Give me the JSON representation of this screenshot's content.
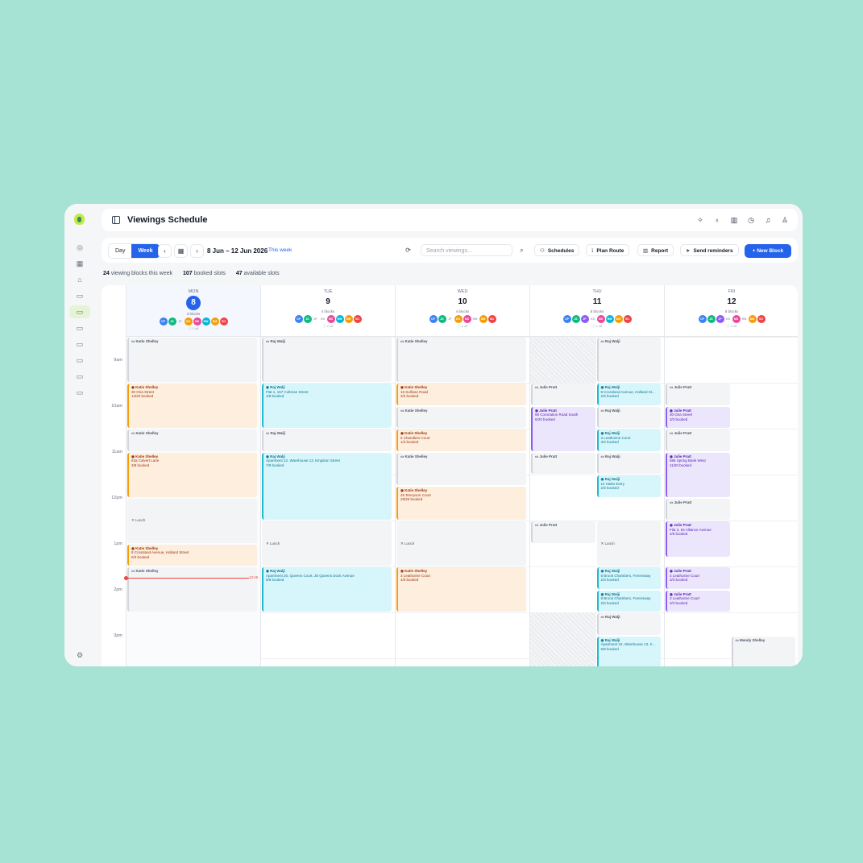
{
  "app": {
    "title": "Viewings Schedule"
  },
  "rail": {
    "icons": [
      "dashboard-icon",
      "calendar-icon",
      "home-icon",
      "folder-icon",
      "folder-icon",
      "folder-icon",
      "folder-icon",
      "folder-icon",
      "folder-icon",
      "folder-icon",
      "settings-icon"
    ],
    "active_index": 4
  },
  "header_icons": [
    "sparkle-icon",
    "lightbulb-icon",
    "map-icon",
    "clock-icon",
    "bell-icon",
    "user-icon"
  ],
  "toolbar": {
    "view_day": "Day",
    "view_week": "Week",
    "active_view": "Week",
    "date_range": "8 Jun – 12 Jun 2026",
    "this_week": "This week",
    "search_placeholder": "Search viewings...",
    "schedules": "Schedules",
    "plan_route": "Plan Route",
    "report": "Report",
    "send_reminders": "Send reminders",
    "new_block": "New Block"
  },
  "summary": {
    "blocks_count": "24",
    "blocks_label": "viewing blocks this week",
    "booked_count": "107",
    "booked_label": "booked slots",
    "available_count": "47",
    "available_label": "available slots"
  },
  "colors": {
    "accent": "#2563eb",
    "orange": "#f59e0b",
    "cyan": "#22b8cf",
    "purple": "#8b5cf6",
    "now": "#ef4444"
  },
  "time_labels": [
    "9am",
    "10am",
    "11am",
    "12pm",
    "1pm",
    "2pm",
    "3pm"
  ],
  "now_time": "13:45",
  "days": [
    {
      "dow": "MON",
      "num": "8",
      "today": true,
      "blocks": "3 blocks",
      "off": "1 off",
      "avatars": [
        [
          "CP",
          "#3b82f6"
        ],
        [
          "JS",
          "#10b981"
        ],
        [
          "JP",
          "faded"
        ],
        [
          "KS",
          "#f59e0b"
        ],
        [
          "MS",
          "#ec4899"
        ],
        [
          "RW",
          "#06b6d4"
        ],
        [
          "DM",
          "#f59e0b"
        ],
        [
          "SO",
          "#ef4444"
        ]
      ]
    },
    {
      "dow": "TUE",
      "num": "9",
      "today": false,
      "blocks": "4 blocks",
      "off": "2 off",
      "avatars": [
        [
          "CP",
          "#3b82f6"
        ],
        [
          "JS",
          "#10b981"
        ],
        [
          "JP",
          "faded"
        ],
        [
          "KS",
          "faded"
        ],
        [
          "MS",
          "#ec4899"
        ],
        [
          "RW",
          "#06b6d4"
        ],
        [
          "DM",
          "#f59e0b"
        ],
        [
          "SO",
          "#ef4444"
        ]
      ]
    },
    {
      "dow": "WED",
      "num": "10",
      "today": false,
      "blocks": "4 blocks",
      "off": "2 off",
      "avatars": [
        [
          "CP",
          "#3b82f6"
        ],
        [
          "JS",
          "#10b981"
        ],
        [
          "JP",
          "faded"
        ],
        [
          "KS",
          "#f59e0b"
        ],
        [
          "MS",
          "#ec4899"
        ],
        [
          "RW",
          "faded"
        ],
        [
          "DM",
          "#f59e0b"
        ],
        [
          "SO",
          "#ef4444"
        ]
      ]
    },
    {
      "dow": "THU",
      "num": "11",
      "today": false,
      "blocks": "8 blocks",
      "off": "1 off",
      "avatars": [
        [
          "CP",
          "#3b82f6"
        ],
        [
          "JS",
          "#10b981"
        ],
        [
          "JP",
          "#8b5cf6"
        ],
        [
          "KS",
          "faded"
        ],
        [
          "MS",
          "#ec4899"
        ],
        [
          "RW",
          "#06b6d4"
        ],
        [
          "DM",
          "#f59e0b"
        ],
        [
          "SO",
          "#ef4444"
        ]
      ]
    },
    {
      "dow": "FRI",
      "num": "12",
      "today": false,
      "blocks": "8 blocks",
      "off": "2 off",
      "avatars": [
        [
          "CP",
          "#3b82f6"
        ],
        [
          "JS",
          "#10b981"
        ],
        [
          "JP",
          "#8b5cf6"
        ],
        [
          "KS",
          "faded"
        ],
        [
          "MS",
          "#ec4899"
        ],
        [
          "RW",
          "faded"
        ],
        [
          "DM",
          "#f59e0b"
        ],
        [
          "SO",
          "#ef4444"
        ]
      ]
    }
  ],
  "events": [
    {
      "day": 0,
      "lane": [
        0,
        1
      ],
      "start": 8.5,
      "end": 9.5,
      "color": "gray",
      "name": "Katie Shelley",
      "addr": "",
      "booked": ""
    },
    {
      "day": 0,
      "lane": [
        0,
        1
      ],
      "start": 9.5,
      "end": 10.5,
      "color": "orange",
      "name": "Katie Shelley",
      "addr": "30 Ona Street",
      "booked": "14/20 booked"
    },
    {
      "day": 0,
      "lane": [
        0,
        1
      ],
      "start": 10.5,
      "end": 11.0,
      "color": "gray",
      "name": "Katie Shelley",
      "addr": "",
      "booked": ""
    },
    {
      "day": 0,
      "lane": [
        0,
        1
      ],
      "start": 11.0,
      "end": 12.0,
      "color": "orange",
      "name": "Katie Shelley",
      "addr": "63a Calvert Lane",
      "booked": "3/8 booked"
    },
    {
      "day": 0,
      "lane": [
        0,
        1
      ],
      "start": 12.0,
      "end": 13.0,
      "color": "lunch",
      "name": "Lunch",
      "addr": "",
      "booked": ""
    },
    {
      "day": 0,
      "lane": [
        0,
        1
      ],
      "start": 13.0,
      "end": 13.5,
      "color": "orange",
      "name": "Katie Shelley",
      "addr": "9 Crossland Avenue, Holland Street",
      "booked": "0/3 booked"
    },
    {
      "day": 0,
      "lane": [
        0,
        1
      ],
      "start": 13.5,
      "end": 14.5,
      "color": "gray",
      "name": "Katie Shelley",
      "addr": "",
      "booked": ""
    },
    {
      "day": 1,
      "lane": [
        0,
        1
      ],
      "start": 8.5,
      "end": 9.5,
      "color": "gray",
      "name": "Raj Walji",
      "addr": "",
      "booked": ""
    },
    {
      "day": 1,
      "lane": [
        0,
        1
      ],
      "start": 9.5,
      "end": 10.5,
      "color": "cyan",
      "name": "Raj Walji",
      "addr": "Flat 1, 157 Coltman Street",
      "booked": "1/8 booked"
    },
    {
      "day": 1,
      "lane": [
        0,
        1
      ],
      "start": 10.5,
      "end": 11.0,
      "color": "gray",
      "name": "Raj Walji",
      "addr": "",
      "booked": ""
    },
    {
      "day": 1,
      "lane": [
        0,
        1
      ],
      "start": 11.0,
      "end": 12.5,
      "color": "cyan",
      "name": "Raj Walji",
      "addr": "Apartment 22, Warehouse 13, Kingston Street",
      "booked": "7/8 booked"
    },
    {
      "day": 1,
      "lane": [
        0,
        1
      ],
      "start": 12.5,
      "end": 13.5,
      "color": "lunch",
      "name": "Lunch",
      "addr": "",
      "booked": ""
    },
    {
      "day": 1,
      "lane": [
        0,
        1
      ],
      "start": 13.5,
      "end": 14.5,
      "color": "cyan",
      "name": "Raj Walji",
      "addr": "Apartment 20, Queens Court, 35 Queens Dock Avenue",
      "booked": "5/6 booked"
    },
    {
      "day": 2,
      "lane": [
        0,
        1
      ],
      "start": 8.5,
      "end": 9.5,
      "color": "gray",
      "name": "Katie Shelley",
      "addr": "",
      "booked": ""
    },
    {
      "day": 2,
      "lane": [
        0,
        1
      ],
      "start": 9.5,
      "end": 10.0,
      "color": "orange",
      "name": "Katie Shelley",
      "addr": "16 Sullivan Road",
      "booked": "3/3 booked"
    },
    {
      "day": 2,
      "lane": [
        0,
        1
      ],
      "start": 10.0,
      "end": 10.5,
      "color": "gray",
      "name": "Katie Shelley",
      "addr": "",
      "booked": ""
    },
    {
      "day": 2,
      "lane": [
        0,
        1
      ],
      "start": 10.5,
      "end": 11.0,
      "color": "orange",
      "name": "Katie Shelley",
      "addr": "6 Chandlers Court",
      "booked": "1/3 booked"
    },
    {
      "day": 2,
      "lane": [
        0,
        1
      ],
      "start": 11.0,
      "end": 11.75,
      "color": "gray",
      "name": "Katie Shelley",
      "addr": "",
      "booked": ""
    },
    {
      "day": 2,
      "lane": [
        0,
        1
      ],
      "start": 11.75,
      "end": 12.5,
      "color": "orange",
      "name": "Katie Shelley",
      "addr": "25 Tennyson Court",
      "booked": "28/20 booked"
    },
    {
      "day": 2,
      "lane": [
        0,
        1
      ],
      "start": 12.5,
      "end": 13.5,
      "color": "lunch",
      "name": "Lunch",
      "addr": "",
      "booked": ""
    },
    {
      "day": 2,
      "lane": [
        0,
        1
      ],
      "start": 13.5,
      "end": 14.5,
      "color": "orange",
      "name": "Katie Shelley",
      "addr": "3 Leathoime Court",
      "booked": "4/6 booked"
    },
    {
      "day": 3,
      "lane": [
        0,
        0.5
      ],
      "start": 9.5,
      "end": 10.0,
      "color": "gray",
      "name": "Julie Pratt",
      "addr": "",
      "booked": ""
    },
    {
      "day": 3,
      "lane": [
        0,
        0.5
      ],
      "start": 10.0,
      "end": 11.0,
      "color": "purple",
      "name": "Julie Pratt",
      "addr": "59 Coronation Road South",
      "booked": "6/20 booked"
    },
    {
      "day": 3,
      "lane": [
        0,
        0.5
      ],
      "start": 11.0,
      "end": 11.5,
      "color": "gray",
      "name": "Julie Pratt",
      "addr": "",
      "booked": ""
    },
    {
      "day": 3,
      "lane": [
        0,
        0.5
      ],
      "start": 12.5,
      "end": 13.0,
      "color": "gray",
      "name": "Julie Pratt",
      "addr": "",
      "booked": ""
    },
    {
      "day": 3,
      "lane": [
        0.5,
        1
      ],
      "start": 8.5,
      "end": 9.5,
      "color": "gray",
      "name": "Raj Walji",
      "addr": "",
      "booked": ""
    },
    {
      "day": 3,
      "lane": [
        0.5,
        1
      ],
      "start": 9.5,
      "end": 10.0,
      "color": "cyan",
      "name": "Raj Walji",
      "addr": "9 Crossland Avenue, Holland St...",
      "booked": "2/3 booked"
    },
    {
      "day": 3,
      "lane": [
        0.5,
        1
      ],
      "start": 10.0,
      "end": 10.5,
      "color": "gray",
      "name": "Raj Walji",
      "addr": "",
      "booked": ""
    },
    {
      "day": 3,
      "lane": [
        0.5,
        1
      ],
      "start": 10.5,
      "end": 11.0,
      "color": "cyan",
      "name": "Raj Walji",
      "addr": "3 Leathoime Court",
      "booked": "3/3 booked"
    },
    {
      "day": 3,
      "lane": [
        0.5,
        1
      ],
      "start": 11.0,
      "end": 11.5,
      "color": "gray",
      "name": "Raj Walji",
      "addr": "",
      "booked": ""
    },
    {
      "day": 3,
      "lane": [
        0.5,
        1
      ],
      "start": 11.5,
      "end": 12.0,
      "color": "cyan",
      "name": "Raj Walji",
      "addr": "12 Hales Entry",
      "booked": "2/3 booked"
    },
    {
      "day": 3,
      "lane": [
        0.5,
        1
      ],
      "start": 12.5,
      "end": 13.5,
      "color": "lunch",
      "name": "Lunch",
      "addr": "",
      "booked": ""
    },
    {
      "day": 3,
      "lane": [
        0.5,
        1
      ],
      "start": 13.5,
      "end": 14.0,
      "color": "cyan",
      "name": "Raj Walji",
      "addr": "8 Brook Chambers, Ferensway",
      "booked": "2/3 booked"
    },
    {
      "day": 3,
      "lane": [
        0.5,
        1
      ],
      "start": 14.0,
      "end": 14.5,
      "color": "cyan",
      "name": "Raj Walji",
      "addr": "8 Brook Chambers, Ferensway",
      "booked": "2/3 booked"
    },
    {
      "day": 3,
      "lane": [
        0.5,
        1
      ],
      "start": 14.5,
      "end": 15.0,
      "color": "gray",
      "name": "Raj Walji",
      "addr": "",
      "booked": ""
    },
    {
      "day": 3,
      "lane": [
        0.5,
        1
      ],
      "start": 15.0,
      "end": 15.75,
      "color": "cyan",
      "name": "Raj Walji",
      "addr": "Apartment 22, Warehouse 13, K...",
      "booked": "6/8 booked"
    },
    {
      "day": 4,
      "lane": [
        0,
        0.5
      ],
      "start": 9.5,
      "end": 10.0,
      "color": "gray",
      "name": "Julie Pratt",
      "addr": "",
      "booked": ""
    },
    {
      "day": 4,
      "lane": [
        0,
        0.5
      ],
      "start": 10.0,
      "end": 10.5,
      "color": "purple",
      "name": "Julie Pratt",
      "addr": "30 Ona Street",
      "booked": "3/3 booked"
    },
    {
      "day": 4,
      "lane": [
        0,
        0.5
      ],
      "start": 10.5,
      "end": 11.0,
      "color": "gray",
      "name": "Julie Pratt",
      "addr": "",
      "booked": ""
    },
    {
      "day": 4,
      "lane": [
        0,
        0.5
      ],
      "start": 11.0,
      "end": 12.0,
      "color": "purple",
      "name": "Julie Pratt",
      "addr": "586 Spring Bank West",
      "booked": "11/20 booked"
    },
    {
      "day": 4,
      "lane": [
        0,
        0.5
      ],
      "start": 12.0,
      "end": 12.5,
      "color": "gray",
      "name": "Julie Pratt",
      "addr": "",
      "booked": ""
    },
    {
      "day": 4,
      "lane": [
        0,
        0.5
      ],
      "start": 12.5,
      "end": 13.3,
      "color": "purple",
      "name": "Julie Pratt",
      "addr": "Flat 2, 84 Alliance Avenue",
      "booked": "4/5 booked"
    },
    {
      "day": 4,
      "lane": [
        0,
        0.5
      ],
      "start": 13.5,
      "end": 14.0,
      "color": "purple",
      "name": "Julie Pratt",
      "addr": "3 Leathoime Court",
      "booked": "3/3 booked"
    },
    {
      "day": 4,
      "lane": [
        0,
        0.5
      ],
      "start": 14.0,
      "end": 14.5,
      "color": "purple",
      "name": "Julie Pratt",
      "addr": "3 Leathoime Court",
      "booked": "3/3 booked"
    },
    {
      "day": 4,
      "lane": [
        0.5,
        1
      ],
      "start": 15.0,
      "end": 15.75,
      "color": "gray",
      "name": "Mandy Shelley",
      "addr": "",
      "booked": ""
    }
  ],
  "hatched": [
    {
      "day": 3,
      "lane": [
        0,
        0.5
      ],
      "start": 8.5,
      "end": 9.5
    },
    {
      "day": 3,
      "lane": [
        0,
        0.5
      ],
      "start": 14.5,
      "end": 15.75
    }
  ]
}
